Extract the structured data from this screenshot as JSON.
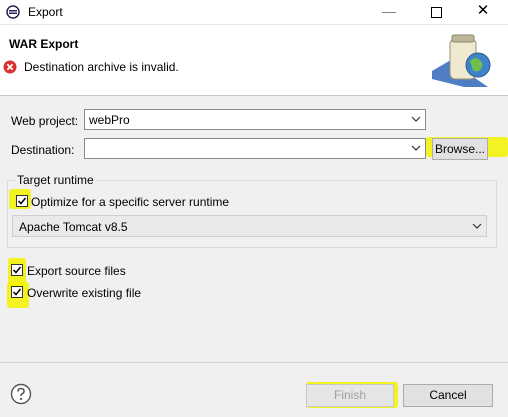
{
  "window": {
    "title": "Export",
    "minimize_icon": "minimize-icon",
    "maximize_icon": "maximize-icon",
    "close_icon": "close-icon"
  },
  "header": {
    "title": "WAR Export",
    "message": "Destination archive is invalid.",
    "message_icon": "error-icon",
    "image_icon": "jar-globe-icon"
  },
  "form": {
    "web_project": {
      "label": "Web project:",
      "value": "webPro"
    },
    "destination": {
      "label": "Destination:",
      "value": "",
      "browse_label": "Browse..."
    }
  },
  "target_runtime": {
    "group_label": "Target runtime",
    "optimize": {
      "label": "Optimize for a specific server runtime",
      "checked": true
    },
    "runtime": {
      "value": "Apache Tomcat v8.5"
    }
  },
  "options": {
    "export_source": {
      "label": "Export source files",
      "checked": true
    },
    "overwrite": {
      "label": "Overwrite existing file",
      "checked": true
    }
  },
  "footer": {
    "help_icon": "help-icon",
    "finish_label": "Finish",
    "cancel_label": "Cancel"
  },
  "colors": {
    "highlight": "#f3f300",
    "error": "#d9302c",
    "window_bg": "#f0f0f0"
  }
}
